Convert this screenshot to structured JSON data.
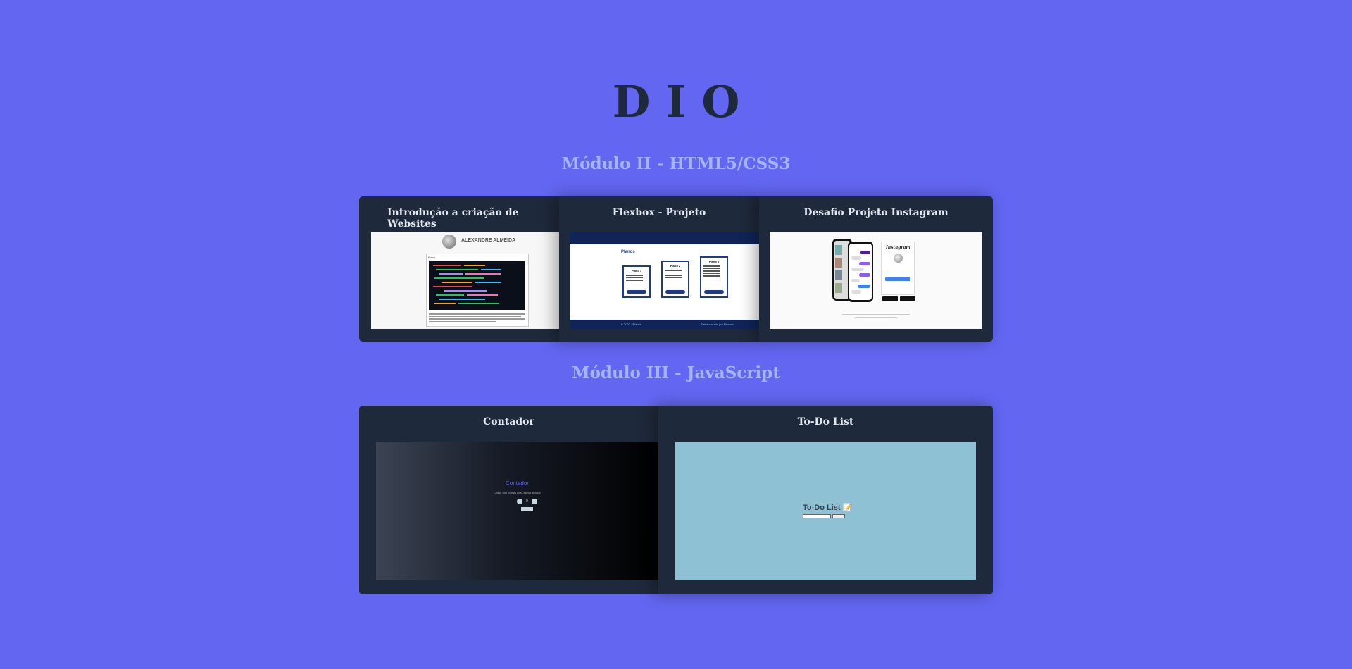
{
  "header": {
    "title": "DIO"
  },
  "modules": [
    {
      "heading": "Módulo II - HTML5/CSS3",
      "projects": [
        {
          "title": "Introdução a criação de Websites",
          "preview": {
            "name": "ALEXANDRE ALMEIDA",
            "section": "Fotos"
          }
        },
        {
          "title": "Flexbox - Projeto",
          "preview": {
            "section": "Planos",
            "plans": [
              "Plano 1",
              "Plano 2",
              "Plano 3"
            ]
          }
        },
        {
          "title": "Desafio Projeto Instagram",
          "preview": {
            "logo": "Instagram"
          }
        }
      ]
    },
    {
      "heading": "Módulo III - JavaScript",
      "projects": [
        {
          "title": "Contador",
          "preview": {
            "title": "Contador",
            "subtitle": "Clique nos botões para alterar o valor",
            "value": "0"
          }
        },
        {
          "title": "To-Do List",
          "preview": {
            "title": "To-Do List 📝"
          }
        }
      ]
    }
  ],
  "colors": {
    "background": "#6366f1",
    "card": "#1e293b",
    "heading": "#a5b4fc",
    "title": "#1e293b"
  }
}
